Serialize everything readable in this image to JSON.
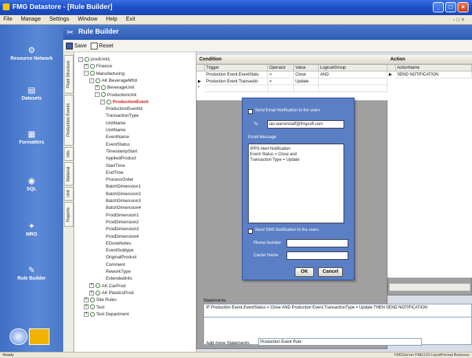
{
  "window": {
    "title": "FMG Datastore - [Rule Builder]",
    "btn_min": "_",
    "btn_max": "□",
    "btn_close": "×"
  },
  "menu": {
    "items": [
      "File",
      "Manage",
      "Settings",
      "Window",
      "Help",
      "Exit"
    ],
    "right": "- □ ×"
  },
  "nav": {
    "items": [
      {
        "label": "Resource Network",
        "icon": "network-icon"
      },
      {
        "label": "Datasets",
        "icon": "datasets-icon"
      },
      {
        "label": "Formatters",
        "icon": "formatter-icon"
      },
      {
        "label": "SQL",
        "icon": "sql-icon"
      },
      {
        "label": "MRO",
        "icon": "mro-icon"
      },
      {
        "label": "Rule Builder",
        "icon": "rule-builder-icon"
      }
    ]
  },
  "header": {
    "title": "Rule Builder"
  },
  "toolbar": {
    "save": "Save",
    "reset": "Reset"
  },
  "vtabs": [
    "Plant Structure",
    "Production Events",
    "Info",
    "Material",
    "Unit",
    "Reports"
  ],
  "tree": [
    {
      "label": "prodUnit1",
      "indent": 0,
      "exp": "-"
    },
    {
      "label": "Finance",
      "indent": 1,
      "exp": "+"
    },
    {
      "label": "Manufacturing",
      "indent": 1,
      "exp": "-"
    },
    {
      "label": "AK BeverageMfrd",
      "indent": 2,
      "exp": "-"
    },
    {
      "label": "BeverageUnit",
      "indent": 3,
      "exp": "+"
    },
    {
      "label": "ProductionUnit",
      "indent": 3,
      "exp": "-"
    },
    {
      "label": "ProductionEvent",
      "indent": 4,
      "exp": "-",
      "selected": true
    },
    {
      "label": "ProductionEventId",
      "indent": 5
    },
    {
      "label": "TransactionType",
      "indent": 5
    },
    {
      "label": "UnitName",
      "indent": 5
    },
    {
      "label": "UnitName",
      "indent": 5
    },
    {
      "label": "EventName",
      "indent": 5
    },
    {
      "label": "EventStatus",
      "indent": 5
    },
    {
      "label": "TimestampStart",
      "indent": 5
    },
    {
      "label": "AppliedProduct",
      "indent": 5
    },
    {
      "label": "StartTime",
      "indent": 5
    },
    {
      "label": "EndTime",
      "indent": 5
    },
    {
      "label": "ProcessOrder",
      "indent": 5
    },
    {
      "label": "BatchDimension1",
      "indent": 5
    },
    {
      "label": "BatchDimension2",
      "indent": 5
    },
    {
      "label": "BatchDimension3",
      "indent": 5
    },
    {
      "label": "BatchDimension4",
      "indent": 5
    },
    {
      "label": "ProdDimension1",
      "indent": 5
    },
    {
      "label": "ProdDimension2",
      "indent": 5
    },
    {
      "label": "ProdDimension3",
      "indent": 5
    },
    {
      "label": "ProdDimension4",
      "indent": 5
    },
    {
      "label": "EDoneNotes",
      "indent": 5
    },
    {
      "label": "EventSubtype",
      "indent": 5
    },
    {
      "label": "OriginalProduct",
      "indent": 5
    },
    {
      "label": "Comment",
      "indent": 5
    },
    {
      "label": "ReworkType",
      "indent": 5
    },
    {
      "label": "ExtendedInfo",
      "indent": 5
    },
    {
      "label": "AK CarProd",
      "indent": 2,
      "exp": "+"
    },
    {
      "label": "AK PlasticsProd",
      "indent": 2,
      "exp": "+"
    },
    {
      "label": "Site Rules",
      "indent": 1,
      "exp": "+"
    },
    {
      "label": "Test",
      "indent": 1,
      "exp": "+"
    },
    {
      "label": "Test Department",
      "indent": 1,
      "exp": "+"
    }
  ],
  "condition": {
    "title": "Condition",
    "headers": [
      "Trigger",
      "Operator",
      "Value",
      "Logical/Group"
    ],
    "rows": [
      {
        "marker": "",
        "trigger": "Production Event.EventStatu",
        "op": "=",
        "value": "Close",
        "logic": "AND"
      },
      {
        "marker": "▶",
        "trigger": "Production Event.Transactio",
        "op": "=",
        "value": "Update",
        "logic": ""
      },
      {
        "marker": "*",
        "trigger": "",
        "op": "",
        "value": "",
        "logic": ""
      }
    ]
  },
  "action": {
    "title": "Action",
    "header": "ActionName",
    "rows": [
      {
        "marker": "▶",
        "name": "SEND NOTIFICATION"
      }
    ]
  },
  "dialog": {
    "email_check_label": "Send Email Notification to the users",
    "to_label": "To",
    "to_value": "ian.warrenstaff@fmgsoft.com",
    "message_label": "Email Message",
    "message_lines": [
      "IPPS Alert Notification",
      "Event Status = Close and",
      "Transaction Type = Update"
    ],
    "sms_check_label": "Send SMS Notification to the users",
    "sms_field1_label": "Phone Number",
    "sms_field2_label": "Carrier Name",
    "ok": "OK",
    "cancel": "Cancel"
  },
  "statements": {
    "label": "Statements",
    "text": "IF Production Event.EventStatus = Close AND Production Event.TransactionType = Update THEN SEND NOTIFICATION",
    "add_label": "Add more Statements",
    "add_value": "Production Event Rule"
  },
  "status": {
    "left": "Ready",
    "right": "FMGServer  FMG123   LiquidFormat Business"
  }
}
